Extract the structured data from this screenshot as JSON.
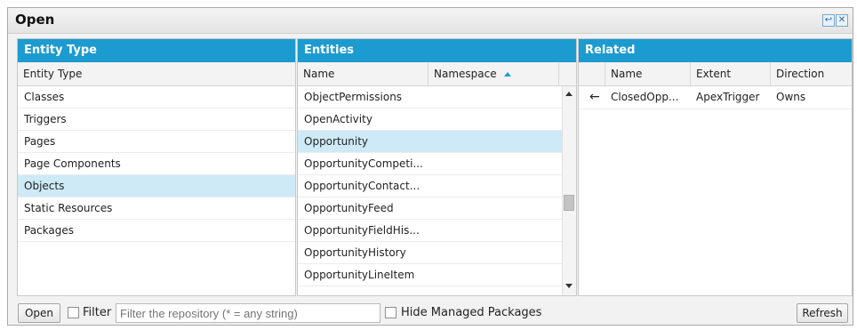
{
  "window": {
    "title": "Open",
    "pin_icon": "pin-icon",
    "close_icon": "close-icon"
  },
  "entity_type_pane": {
    "header": "Entity Type",
    "column": "Entity Type",
    "items": [
      "Classes",
      "Triggers",
      "Pages",
      "Page Components",
      "Objects",
      "Static Resources",
      "Packages"
    ],
    "selected": "Objects"
  },
  "entities_pane": {
    "header": "Entities",
    "columns": {
      "name": "Name",
      "namespace": "Namespace"
    },
    "sort_icon": "sort-ascending-icon",
    "items": [
      "ObjectPermissions",
      "OpenActivity",
      "Opportunity",
      "OpportunityCompeti...",
      "OpportunityContact...",
      "OpportunityFeed",
      "OpportunityFieldHis...",
      "OpportunityHistory",
      "OpportunityLineItem"
    ],
    "selected": "Opportunity"
  },
  "related_pane": {
    "header": "Related",
    "columns": {
      "name": "Name",
      "extent": "Extent",
      "direction": "Direction"
    },
    "rows": [
      {
        "icon": "left-arrow-icon",
        "arrow": "←",
        "name": "ClosedOpp...",
        "extent": "ApexTrigger",
        "direction": "Owns"
      }
    ]
  },
  "toolbar": {
    "open_label": "Open",
    "filter_label": "Filter",
    "filter_placeholder": "Filter the repository (* = any string)",
    "filter_value": "",
    "hide_managed_label": "Hide Managed Packages",
    "refresh_label": "Refresh"
  }
}
